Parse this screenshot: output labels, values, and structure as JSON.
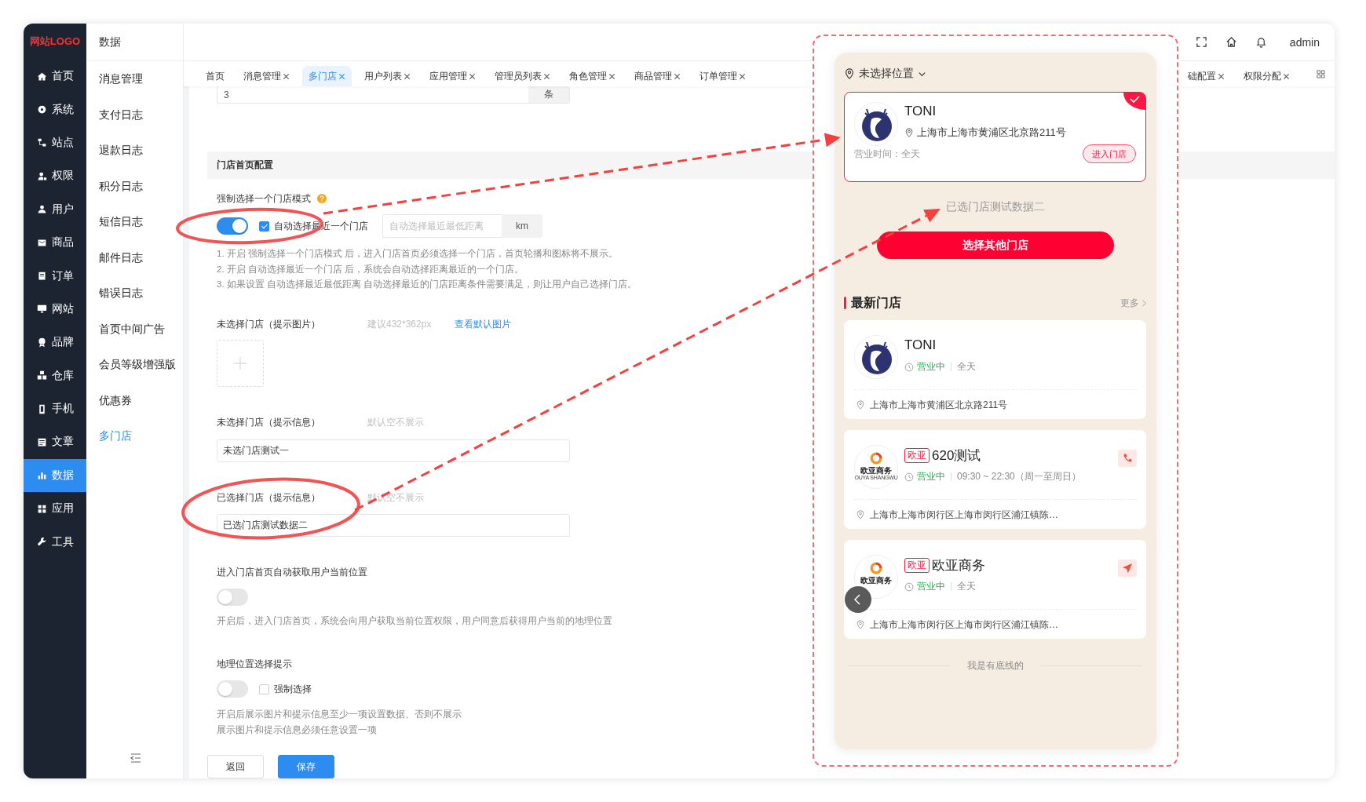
{
  "sidebar": {
    "logo": "网站LOGO",
    "items": [
      {
        "label": "首页",
        "selected": false
      },
      {
        "label": "系统",
        "selected": false
      },
      {
        "label": "站点",
        "selected": false
      },
      {
        "label": "权限",
        "selected": false
      },
      {
        "label": "用户",
        "selected": false
      },
      {
        "label": "商品",
        "selected": false
      },
      {
        "label": "订单",
        "selected": false
      },
      {
        "label": "网站",
        "selected": false
      },
      {
        "label": "品牌",
        "selected": false
      },
      {
        "label": "仓库",
        "selected": false
      },
      {
        "label": "手机",
        "selected": false
      },
      {
        "label": "文章",
        "selected": false
      },
      {
        "label": "数据",
        "selected": true
      },
      {
        "label": "应用",
        "selected": false
      },
      {
        "label": "工具",
        "selected": false
      }
    ]
  },
  "submenu": {
    "title": "数据",
    "items": [
      {
        "label": "消息管理",
        "selected": false
      },
      {
        "label": "支付日志",
        "selected": false
      },
      {
        "label": "退款日志",
        "selected": false
      },
      {
        "label": "积分日志",
        "selected": false
      },
      {
        "label": "短信日志",
        "selected": false
      },
      {
        "label": "邮件日志",
        "selected": false
      },
      {
        "label": "错误日志",
        "selected": false
      },
      {
        "label": "首页中间广告",
        "selected": false
      },
      {
        "label": "会员等级增强版",
        "selected": false
      },
      {
        "label": "优惠券",
        "selected": false
      },
      {
        "label": "多门店",
        "selected": true
      }
    ]
  },
  "header": {
    "user": "admin"
  },
  "tabs": [
    {
      "label": "首页",
      "closable": false,
      "selected": false
    },
    {
      "label": "消息管理",
      "closable": true,
      "selected": false
    },
    {
      "label": "多门店",
      "closable": true,
      "selected": true
    },
    {
      "label": "用户列表",
      "closable": true,
      "selected": false
    },
    {
      "label": "应用管理",
      "closable": true,
      "selected": false
    },
    {
      "label": "管理员列表",
      "closable": true,
      "selected": false
    },
    {
      "label": "角色管理",
      "closable": true,
      "selected": false
    },
    {
      "label": "商品管理",
      "closable": true,
      "selected": false
    },
    {
      "label": "订单管理",
      "closable": true,
      "selected": false
    }
  ],
  "tabs_right": [
    {
      "label": "础配置",
      "closable": true,
      "selected": false
    },
    {
      "label": "权限分配",
      "closable": true,
      "selected": false
    }
  ],
  "form": {
    "top_input": {
      "value": "3",
      "suffix": "条"
    },
    "section_title": "门店首页配置",
    "force_mode": {
      "label": "强制选择一个门店模式",
      "switch_on": true,
      "auto_nearest": {
        "label": "自动选择最近一个门店",
        "checked": true
      },
      "distance": {
        "placeholder": "自动选择最近最低距离",
        "suffix": "km"
      },
      "help": [
        "1. 开启 强制选择一个门店模式 后，进入门店首页必须选择一个门店，首页轮播和图标将不展示。",
        "2. 开启 自动选择最近一个门店 后，系统会自动选择距离最近的一个门店。",
        "3. 如果设置 自动选择最近最低距离 自动选择最近的门店距离条件需要满足，则让用户自己选择门店。"
      ]
    },
    "image_hint": {
      "label": "未选择门店（提示图片）",
      "hint": "建议432*362px",
      "link": "查看默认图片"
    },
    "unselected_info": {
      "label": "未选择门店（提示信息）",
      "hint": "默认空不展示",
      "value": "未选门店测试一"
    },
    "selected_info": {
      "label": "已选择门店（提示信息）",
      "hint": "默认空不展示",
      "value": "已选门店测试数据二"
    },
    "auto_location": {
      "label": "进入门店首页自动获取用户当前位置",
      "on": false,
      "help": "开启后，进入门店首页，系统会向用户获取当前位置权限，用户同意后获得用户当前的地理位置"
    },
    "geo_prompt": {
      "label": "地理位置选择提示",
      "on": false,
      "force": {
        "label": "强制选择",
        "checked": false
      },
      "help": [
        "开启后展示图片和提示信息至少一项设置数据、否则不展示",
        "展示图片和提示信息必须任意设置一项"
      ]
    },
    "buttons": {
      "back": "返回",
      "save": "保存"
    }
  },
  "preview": {
    "location": "未选择位置",
    "current_store": {
      "logo": {
        "kind": "deer"
      },
      "name": "TONI",
      "address": "上海市上海市黄浦区北京路211号",
      "hours": "营业时间：全天",
      "enter": "进入门店",
      "selected": true
    },
    "selected_tip": "已选门店测试数据二",
    "choose_button": "选择其他门店",
    "latest_title": "最新门店",
    "more": "更多",
    "stores": [
      {
        "logo": {
          "kind": "deer"
        },
        "name": "TONI",
        "status": "营业中",
        "hours": "全天",
        "address": "上海市上海市黄浦区北京路211号",
        "kind": "plain"
      },
      {
        "logo": {
          "kind": "ouya",
          "text": "欧亚商务",
          "subtext": "OUYA SHANGWU"
        },
        "tag": "欧亚",
        "name": "620测试",
        "status": "营业中",
        "hours": "09:30 ~ 22:30（周一至周日）",
        "address": "上海市上海市闵行区上海市闵行区浦江镇陈…",
        "kind": "call"
      },
      {
        "logo": {
          "kind": "ouya",
          "text": "欧亚商务"
        },
        "tag": "欧亚",
        "name": "欧亚商务",
        "status": "营业中",
        "hours": "全天",
        "address": "上海市上海市闵行区上海市闵行区浦江镇陈…",
        "kind": "navigate"
      }
    ],
    "footer": "我是有底线的"
  }
}
